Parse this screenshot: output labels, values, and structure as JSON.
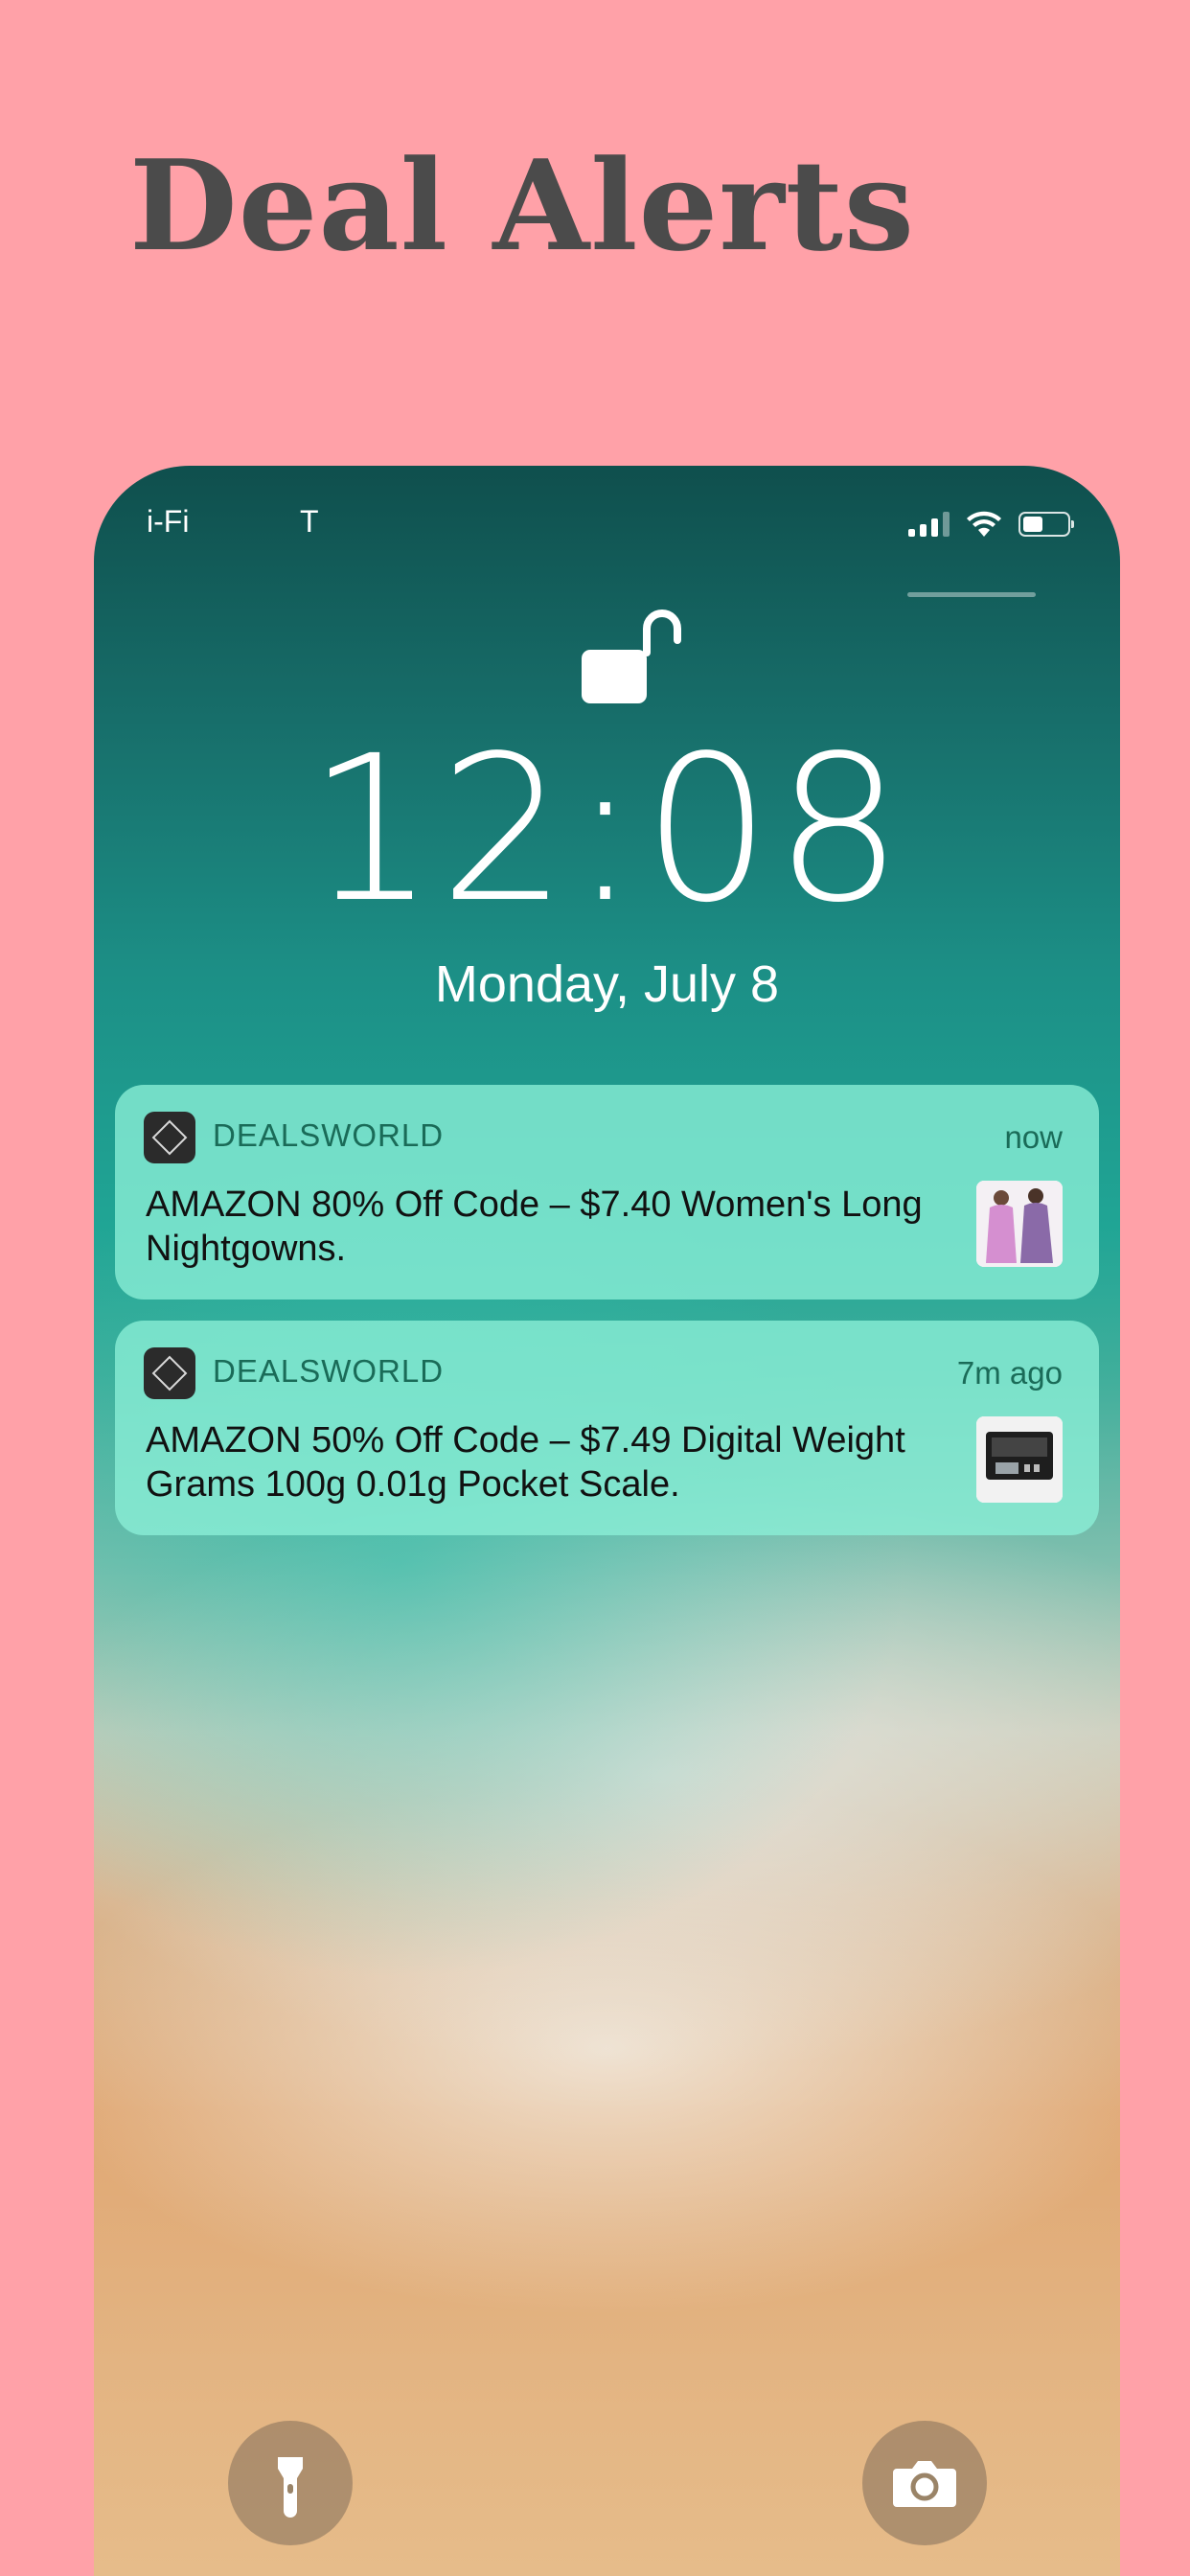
{
  "headline": "Deal Alerts",
  "status_bar": {
    "carrier": "i-Fi",
    "carrier_suffix": "T"
  },
  "lock_screen": {
    "time": "12:08",
    "date": "Monday, July 8"
  },
  "notifications": [
    {
      "app": "DEALSWORLD",
      "time": "now",
      "text": "AMAZON 80% Off Code – $7.40 Women's Long Nightgowns.",
      "thumbnail": "nightgowns-thumbnail"
    },
    {
      "app": "DEALSWORLD",
      "time": "7m ago",
      "text": "AMAZON 50% Off Code – $7.49 Digital Weight Grams 100g 0.01g Pocket Scale.",
      "thumbnail": "pocket-scale-thumbnail"
    }
  ],
  "controls": {
    "left_icon": "flashlight-icon",
    "right_icon": "camera-icon"
  },
  "colors": {
    "background": "#ffa1a8",
    "headline": "#4b4b4b",
    "notification_bg": "#8cf0d7",
    "app_name": "#1a6b58"
  }
}
